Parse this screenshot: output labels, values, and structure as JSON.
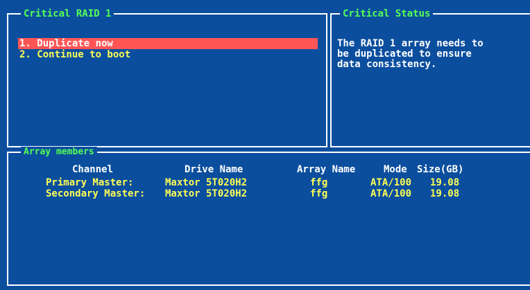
{
  "colors": {
    "background": "#0b4e9e",
    "border": "#ffffff",
    "title": "#55ff55",
    "menu_text": "#ffff55",
    "highlight_bg": "#ff5555",
    "body_text": "#ffffff"
  },
  "menu_panel": {
    "title": "Critical RAID 1",
    "items": [
      {
        "label": "1. Duplicate now",
        "selected": true
      },
      {
        "label": "2. Continue to boot",
        "selected": false
      }
    ]
  },
  "status_panel": {
    "title": "Critical Status",
    "message": "The RAID 1 array needs to\nbe duplicated to ensure\ndata consistency."
  },
  "members_panel": {
    "title": "Array members",
    "columns": [
      "Channel",
      "Drive Name",
      "Array Name",
      "Mode",
      "Size(GB)"
    ],
    "rows": [
      {
        "channel": "Primary Master:",
        "drive": "Maxtor 5T020H2",
        "array": "ffg",
        "mode": "ATA/100",
        "size": "19.08"
      },
      {
        "channel": "Secondary Master:",
        "drive": "Maxtor 5T020H2",
        "array": "ffg",
        "mode": "ATA/100",
        "size": "19.08"
      }
    ]
  }
}
